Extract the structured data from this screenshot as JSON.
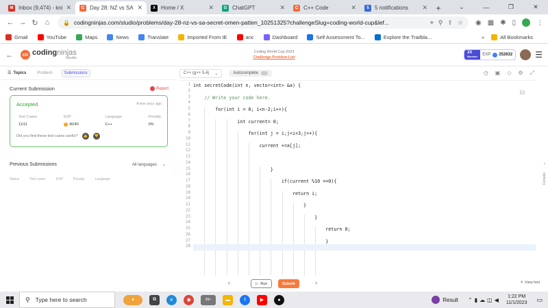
{
  "browser": {
    "tabs": [
      {
        "title": "Inbox (9,474) - kni",
        "favicon": "gmail-icon",
        "color": "#d93025",
        "glyph": "M"
      },
      {
        "title": "Day 28: NZ vs SA",
        "favicon": "codingninjas-icon",
        "color": "#f66c3b",
        "glyph": "C"
      },
      {
        "title": "Home / X",
        "favicon": "x-icon",
        "color": "#000000",
        "glyph": "X"
      },
      {
        "title": "ChatGPT",
        "favicon": "chatgpt-icon",
        "color": "#10a37f",
        "glyph": "G"
      },
      {
        "title": "C++ Code",
        "favicon": "codingninjas-icon",
        "color": "#f66c3b",
        "glyph": "C"
      },
      {
        "title": "5 notifications",
        "favicon": "bell-icon",
        "color": "#3b6ad6",
        "glyph": "5"
      }
    ],
    "url": "codingninjas.com/studio/problems/day-28-nz-vs-sa-secret-omen-patten_10251325?challengeSlug=coding-world-cup&lef...",
    "bookmarks": [
      {
        "label": "Gmail",
        "color": "#d93025"
      },
      {
        "label": "YouTube",
        "color": "#ff0000"
      },
      {
        "label": "Maps",
        "color": "#34a853"
      },
      {
        "label": "News",
        "color": "#4285f4"
      },
      {
        "label": "Translate",
        "color": "#4285f4"
      },
      {
        "label": "Imported From IE",
        "color": "#f4b400"
      },
      {
        "label": "anc",
        "color": "#ff0000"
      },
      {
        "label": "Dashboard",
        "color": "#7b61ff"
      },
      {
        "label": "Self Assessment To...",
        "color": "#1a73e8"
      },
      {
        "label": "Explore the Trailbla...",
        "color": "#0070d2"
      }
    ],
    "all_bookmarks": "All Bookmarks"
  },
  "site": {
    "logo_main": "coding",
    "logo_accent": "ninjas",
    "logo_sub": "/studio",
    "contest_title": "Coding World Cup 2023",
    "contest_link": "Challenge Problem List",
    "booster_multiplier": "2X",
    "booster_label": "Booster",
    "exp_label": "EXP",
    "exp_value": "252632"
  },
  "left": {
    "tabs": {
      "topics": "Topics",
      "problem": "Problem",
      "submissions": "Submissions"
    },
    "current_submission": "Current Submission",
    "report": "Report",
    "status": "Accepted",
    "when": "A few secs ago",
    "cols": [
      {
        "key": "Test Cases",
        "value": "11/11"
      },
      {
        "key": "EXP",
        "value": "40/40"
      },
      {
        "key": "Language",
        "value": "C++"
      },
      {
        "key": "Penalty",
        "value": "0%"
      }
    ],
    "feedback_q": "Did you find these test cases useful?",
    "previous_title": "Previous Submissions",
    "language_filter": "All languages",
    "prev_cols": [
      "Status",
      "Test cases",
      "EXP",
      "Penalty",
      "Language"
    ]
  },
  "editor": {
    "language": "C++ (g++ 5.4)",
    "autocomplete": "Autocomplete",
    "lines": [
      "int secretCode(int n, vector<int> &a) {",
      "",
      "    // Write your code here.",
      "",
      "        for(int i = 0; i<n-2;i++){",
      "",
      "                int current= 0;",
      "",
      "                    for(int j = i;j<i+3;j++){",
      "",
      "                        current +=a[j];",
      "",
      "",
      "",
      "                            }",
      "",
      "                                if(current %10 ==0){",
      "",
      "                                    return i;",
      "",
      "                                        }",
      "",
      "                                            }",
      "",
      "                                                return 0;",
      "",
      "                                                }",
      ""
    ]
  },
  "bottom": {
    "run": "Run",
    "submit": "Submit",
    "view_hint": "View hint",
    "console": "Console"
  },
  "taskbar": {
    "search_placeholder": "Type here to search",
    "badge": "99+",
    "result_label": "Result",
    "time": "1:22 PM",
    "date": "11/1/2023"
  }
}
